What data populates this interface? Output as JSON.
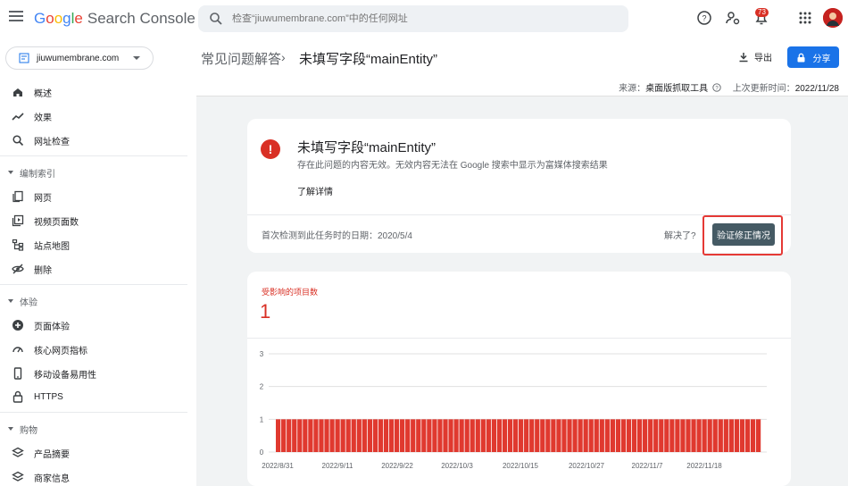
{
  "header": {
    "brand_google": [
      "G",
      "o",
      "o",
      "g",
      "l",
      "e"
    ],
    "brand_product": "Search Console",
    "search_placeholder": "检查“jiuwumembrane.com”中的任何网址",
    "notification_count": "73",
    "icons": [
      "menu-icon",
      "search-icon",
      "help-icon",
      "manage-users-icon",
      "bell-icon",
      "apps-icon",
      "avatar"
    ]
  },
  "sidebar": {
    "property": "jiuwumembrane.com",
    "items": [
      {
        "label": "概述",
        "icon": "home-icon"
      },
      {
        "label": "效果",
        "icon": "trending-icon"
      },
      {
        "label": "网址检查",
        "icon": "search-icon"
      }
    ],
    "sections": [
      {
        "label": "编制索引",
        "items": [
          {
            "label": "网页",
            "icon": "pages-icon"
          },
          {
            "label": "视频页面数",
            "icon": "video-icon"
          },
          {
            "label": "站点地图",
            "icon": "sitemap-icon"
          },
          {
            "label": "删除",
            "icon": "removals-icon"
          }
        ]
      },
      {
        "label": "体验",
        "items": [
          {
            "label": "页面体验",
            "icon": "plus-circle-icon"
          },
          {
            "label": "核心网页指标",
            "icon": "gauge-icon"
          },
          {
            "label": "移动设备易用性",
            "icon": "phone-icon"
          },
          {
            "label": "HTTPS",
            "icon": "lock-icon"
          }
        ]
      },
      {
        "label": "购物",
        "items": [
          {
            "label": "产品摘要",
            "icon": "layers-icon"
          },
          {
            "label": "商家信息",
            "icon": "layers-icon"
          }
        ]
      }
    ]
  },
  "main": {
    "breadcrumb_parent": "常见问题解答",
    "breadcrumb_sep": "›",
    "breadcrumb_current": "未填写字段“mainEntity”",
    "export_label": "导出",
    "share_label": "分享",
    "source_label": "来源：",
    "source_value": "桌面版抓取工具",
    "last_updated_label": "上次更新时间：",
    "last_updated_value": "2022/11/28",
    "issue": {
      "title": "未填写字段“mainEntity”",
      "description": "存在此问题的内容无效。无效内容无法在 Google 搜索中显示为富媒体搜索结果",
      "learn_more": "了解详情",
      "first_detected": "首次检测到此任务时的日期：2020/5/4",
      "resolved_q": "解决了?",
      "validate_label": "验证修正情况"
    },
    "affected_label": "受影响的项目数",
    "affected_count": "1"
  },
  "colors": {
    "accent": "#1a73e8",
    "error": "#d93025",
    "bar": "#e0392f",
    "validate_bg": "#455a64"
  },
  "chart_data": {
    "type": "bar",
    "ylim": [
      0,
      3
    ],
    "yticks": [
      "0",
      "1",
      "2",
      "3"
    ],
    "xticks": [
      "2022/8/31",
      "2022/9/11",
      "2022/9/22",
      "2022/10/3",
      "2022/10/15",
      "2022/10/27",
      "2022/11/7",
      "2022/11/18"
    ],
    "bar_count": 90,
    "value": 1
  }
}
